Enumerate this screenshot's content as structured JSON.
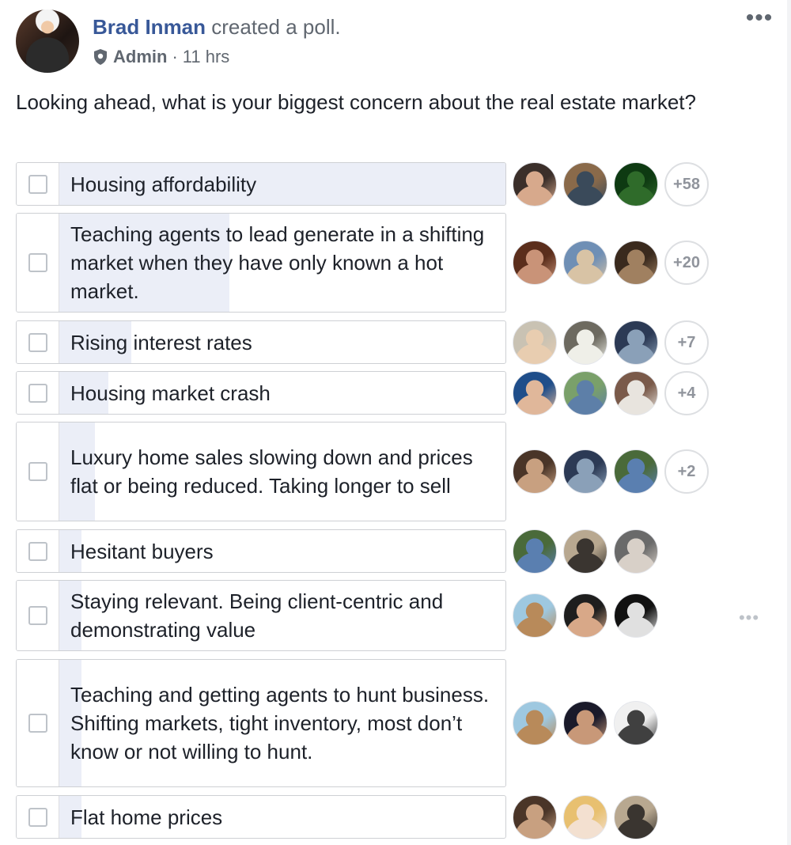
{
  "post": {
    "author": "Brad Inman",
    "action": "created a poll.",
    "role": "Admin",
    "separator": "·",
    "time": "11 hrs",
    "more": "•••"
  },
  "poll": {
    "question": "Looking ahead, what is your biggest concern about the real estate market?",
    "options": [
      {
        "label": "Housing affordability",
        "vote_share": 1.0,
        "extra_voters": "+58",
        "voters": [
          {
            "name": "voter-avatar",
            "colors": [
              "#3b2f2a",
              "#d7a98c"
            ]
          },
          {
            "name": "voter-avatar",
            "colors": [
              "#8a6a4a",
              "#3a4a5a"
            ]
          },
          {
            "name": "voter-avatar",
            "colors": [
              "#0e3a12",
              "#2f6b2a"
            ]
          }
        ]
      },
      {
        "label": "Teaching agents to lead generate in a shifting market when they have only known a hot market.",
        "vote_share": 0.38,
        "extra_voters": "+20",
        "voters": [
          {
            "name": "voter-avatar",
            "colors": [
              "#5b2e1c",
              "#c99378"
            ]
          },
          {
            "name": "voter-avatar",
            "colors": [
              "#6f8fb5",
              "#d8c3a5"
            ]
          },
          {
            "name": "voter-avatar",
            "colors": [
              "#3a2a1e",
              "#a08060"
            ]
          }
        ]
      },
      {
        "label": "Rising interest rates",
        "vote_share": 0.16,
        "extra_voters": "+7",
        "voters": [
          {
            "name": "voter-avatar",
            "colors": [
              "#c9c2b3",
              "#e8cdb0"
            ]
          },
          {
            "name": "voter-avatar",
            "colors": [
              "#6d6a60",
              "#efefe8"
            ]
          },
          {
            "name": "voter-avatar",
            "colors": [
              "#2c3a55",
              "#8aa0b8"
            ]
          }
        ]
      },
      {
        "label": "Housing market crash",
        "vote_share": 0.11,
        "extra_voters": "+4",
        "voters": [
          {
            "name": "voter-avatar",
            "colors": [
              "#1f4e8a",
              "#e0b79a"
            ]
          },
          {
            "name": "voter-avatar",
            "colors": [
              "#7aa06a",
              "#5d7fa8"
            ]
          },
          {
            "name": "voter-avatar",
            "colors": [
              "#7a5a4a",
              "#e8e4de"
            ]
          }
        ]
      },
      {
        "label": "Luxury home sales slowing down and prices flat or being reduced. Taking longer to sell",
        "vote_share": 0.08,
        "extra_voters": "+2",
        "voters": [
          {
            "name": "voter-avatar",
            "colors": [
              "#4a3528",
              "#c8a080"
            ]
          },
          {
            "name": "voter-avatar",
            "colors": [
              "#2c3a55",
              "#8aa0b8"
            ]
          },
          {
            "name": "voter-avatar",
            "colors": [
              "#4a6a3a",
              "#5a7fb0"
            ]
          }
        ]
      },
      {
        "label": "Hesitant buyers",
        "vote_share": 0.05,
        "extra_voters": "",
        "voters": [
          {
            "name": "voter-avatar",
            "colors": [
              "#4a6a3a",
              "#5a7fb0"
            ]
          },
          {
            "name": "voter-avatar",
            "colors": [
              "#b8a890",
              "#3a3530"
            ]
          },
          {
            "name": "voter-avatar",
            "colors": [
              "#6a6a6a",
              "#d8d0c8"
            ]
          }
        ]
      },
      {
        "label": "Staying relevant. Being client-centric and demonstrating value",
        "vote_share": 0.05,
        "extra_voters": "",
        "voters": [
          {
            "name": "voter-avatar",
            "colors": [
              "#9ec8e0",
              "#b88a5a"
            ]
          },
          {
            "name": "voter-avatar",
            "colors": [
              "#1e1e1e",
              "#d8a888"
            ]
          },
          {
            "name": "voter-avatar",
            "colors": [
              "#111111",
              "#e0e0e0"
            ]
          }
        ]
      },
      {
        "label": "Teaching and getting agents to hunt business. Shifting markets, tight inventory, most don’t know or not willing to hunt.",
        "vote_share": 0.05,
        "extra_voters": "",
        "voters": [
          {
            "name": "voter-avatar",
            "colors": [
              "#9ec8e0",
              "#b88a5a"
            ]
          },
          {
            "name": "voter-avatar",
            "colors": [
              "#1a1a2a",
              "#c89878"
            ]
          },
          {
            "name": "voter-avatar",
            "colors": [
              "#f0f0f0",
              "#404040"
            ]
          }
        ]
      },
      {
        "label": "Flat home prices",
        "vote_share": 0.05,
        "extra_voters": "",
        "voters": [
          {
            "name": "voter-avatar",
            "colors": [
              "#4a3528",
              "#c8a080"
            ]
          },
          {
            "name": "voter-avatar",
            "colors": [
              "#e8c070",
              "#f3e0d0"
            ]
          },
          {
            "name": "voter-avatar",
            "colors": [
              "#b8a890",
              "#3a3530"
            ]
          }
        ]
      }
    ],
    "row_more": "•••"
  },
  "colors": {
    "link": "#385898",
    "secondary_text": "#606770",
    "bar_fill": "#ebeef7",
    "border": "#ced0d4"
  }
}
